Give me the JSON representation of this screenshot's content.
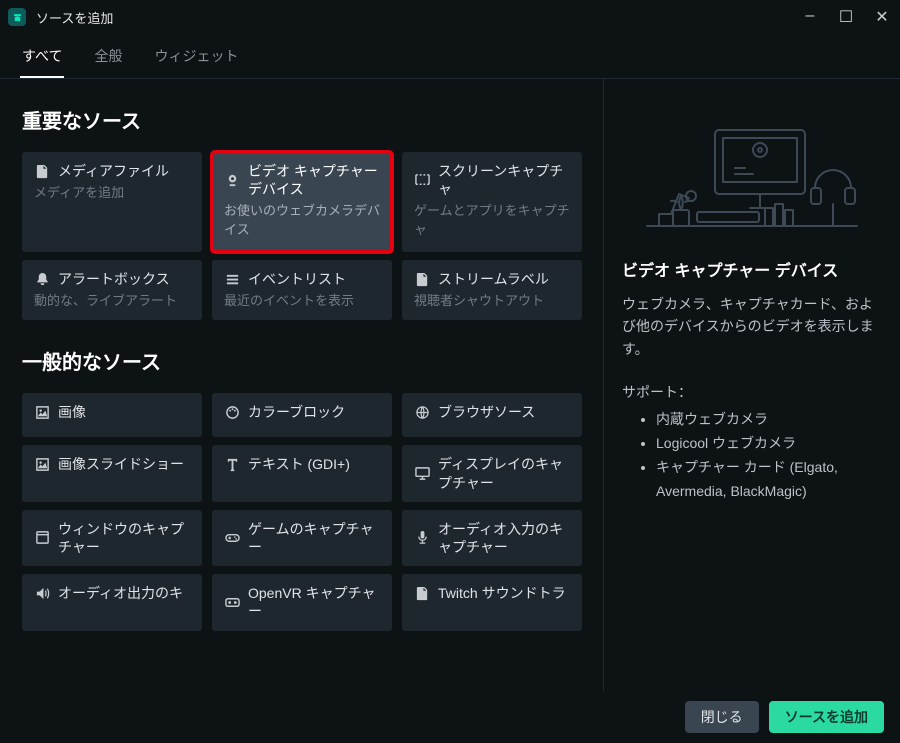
{
  "window": {
    "title": "ソースを追加",
    "minimize": "–",
    "maximize": "☐",
    "close": "✕"
  },
  "tabs": [
    {
      "label": "すべて",
      "active": true
    },
    {
      "label": "全般",
      "active": false
    },
    {
      "label": "ウィジェット",
      "active": false
    }
  ],
  "sections": {
    "important": {
      "title": "重要なソース",
      "cards": [
        {
          "icon": "file-icon",
          "title": "メディアファイル",
          "desc": "メディアを追加",
          "tall": true
        },
        {
          "icon": "webcam-icon",
          "title": "ビデオ キャプチャー デバイス",
          "desc": "お使いのウェブカメラデバイス",
          "tall": true,
          "highlight": true
        },
        {
          "icon": "screen-icon",
          "title": "スクリーンキャプチャ",
          "desc": "ゲームとアプリをキャプチャ",
          "tall": true
        },
        {
          "icon": "bell-icon",
          "title": "アラートボックス",
          "desc": "動的な、ライブアラート"
        },
        {
          "icon": "list-icon",
          "title": "イベントリスト",
          "desc": "最近のイベントを表示"
        },
        {
          "icon": "file-icon",
          "title": "ストリームラベル",
          "desc": "視聴者シャウトアウト"
        }
      ]
    },
    "common": {
      "title": "一般的なソース",
      "cards": [
        {
          "icon": "image-icon",
          "title": "画像",
          "desc": ""
        },
        {
          "icon": "palette-icon",
          "title": "カラーブロック",
          "desc": ""
        },
        {
          "icon": "globe-icon",
          "title": "ブラウザソース",
          "desc": ""
        },
        {
          "icon": "image-icon",
          "title": "画像スライドショー",
          "desc": ""
        },
        {
          "icon": "text-icon",
          "title": "テキスト (GDI+)",
          "desc": ""
        },
        {
          "icon": "display-icon",
          "title": "ディスプレイのキャプチャー",
          "desc": ""
        },
        {
          "icon": "window-icon",
          "title": "ウィンドウのキャプチャー",
          "desc": ""
        },
        {
          "icon": "gamepad-icon",
          "title": "ゲームのキャプチャー",
          "desc": ""
        },
        {
          "icon": "mic-icon",
          "title": "オーディオ入力のキャプチャー",
          "desc": ""
        },
        {
          "icon": "speaker-icon",
          "title": "オーディオ出力のキ",
          "desc": ""
        },
        {
          "icon": "vr-icon",
          "title": "OpenVR キャプチャー",
          "desc": ""
        },
        {
          "icon": "file-icon",
          "title": "Twitch サウンドトラ",
          "desc": ""
        }
      ]
    }
  },
  "detail": {
    "title": "ビデオ キャプチャー デバイス",
    "desc": "ウェブカメラ、キャプチャカード、および他のデバイスからのビデオを表示します。",
    "support_label": "サポート：",
    "support_items": [
      "内蔵ウェブカメラ",
      "Logicool ウェブカメラ",
      "キャプチャー カード (Elgato, Avermedia, BlackMagic)"
    ]
  },
  "footer": {
    "cancel": "閉じる",
    "add": "ソースを追加"
  }
}
